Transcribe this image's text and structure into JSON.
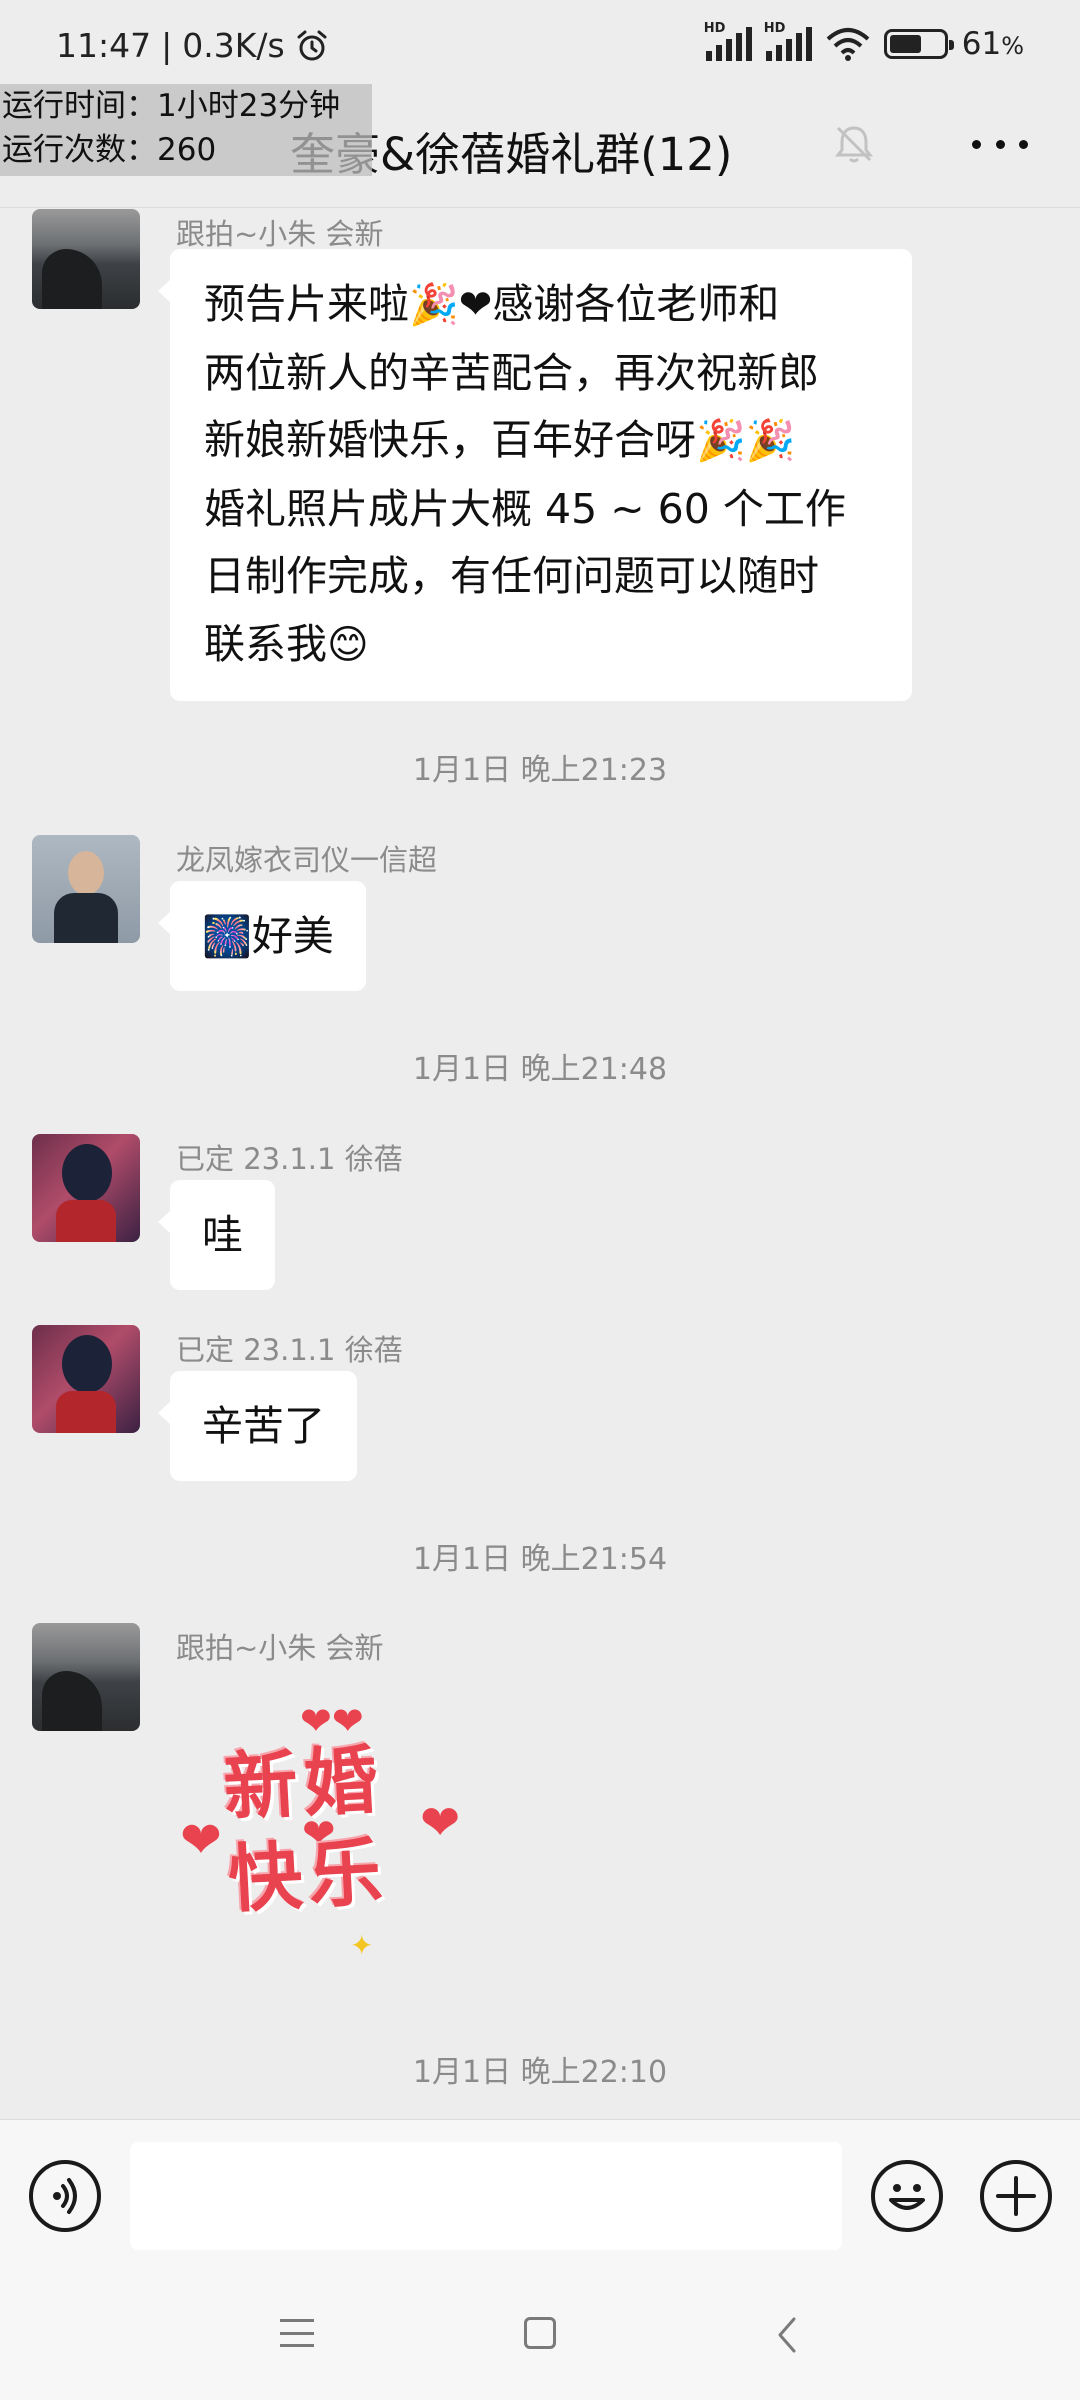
{
  "status_bar": {
    "time": "11:47",
    "network_speed": "0.3K/s",
    "battery_level": "61",
    "battery_unit": "%",
    "battery_fraction": 0.61,
    "icons": [
      "alarm-icon",
      "hd-signal-icon",
      "hd-signal-icon",
      "wifi-icon",
      "battery-icon"
    ]
  },
  "overlay": {
    "runtime_label": "运行时间：1小时23分钟",
    "run_count_label": "运行次数：260"
  },
  "header": {
    "title": "奎豪&徐蓓婚礼群(12)",
    "icons": [
      "mute-icon",
      "more-icon"
    ]
  },
  "messages": [
    {
      "sender": "跟拍~小朱 会新",
      "lines": [
        {
          "text": "预告片来啦",
          "emoji": "🎉❤",
          "after": "感谢各位老师和"
        },
        {
          "text": "两位新人的辛苦配合，再次祝新郎"
        },
        {
          "text": "新娘新婚快乐，百年好合呀",
          "emoji": "🎉🎉"
        },
        {
          "text": "婚礼照片成片大概 45 ~ 60 个工作"
        },
        {
          "text": "日制作完成，有任何问题可以随时"
        },
        {
          "text": "联系我",
          "emoji": "😊"
        }
      ]
    },
    {
      "timestamp": "1月1日 晚上21:23"
    },
    {
      "sender": "龙凤嫁衣司仪一信超",
      "emoji": "🎆",
      "text": "好美"
    },
    {
      "timestamp": "1月1日 晚上21:48"
    },
    {
      "sender": "已定 23.1.1 徐蓓",
      "text": "哇"
    },
    {
      "sender": "已定 23.1.1 徐蓓",
      "text": "辛苦了"
    },
    {
      "timestamp": "1月1日 晚上21:54"
    },
    {
      "sender": "跟拍~小朱 会新",
      "sticker_text_1": "新婚",
      "sticker_text_2": "快乐"
    },
    {
      "timestamp": "1月1日 晚上22:10"
    }
  ],
  "input_bar": {
    "value": "",
    "icons": [
      "voice-icon",
      "emoji-icon",
      "plus-icon"
    ]
  },
  "nav_bar": {
    "icons": [
      "menu-icon",
      "home-icon",
      "back-icon"
    ]
  }
}
